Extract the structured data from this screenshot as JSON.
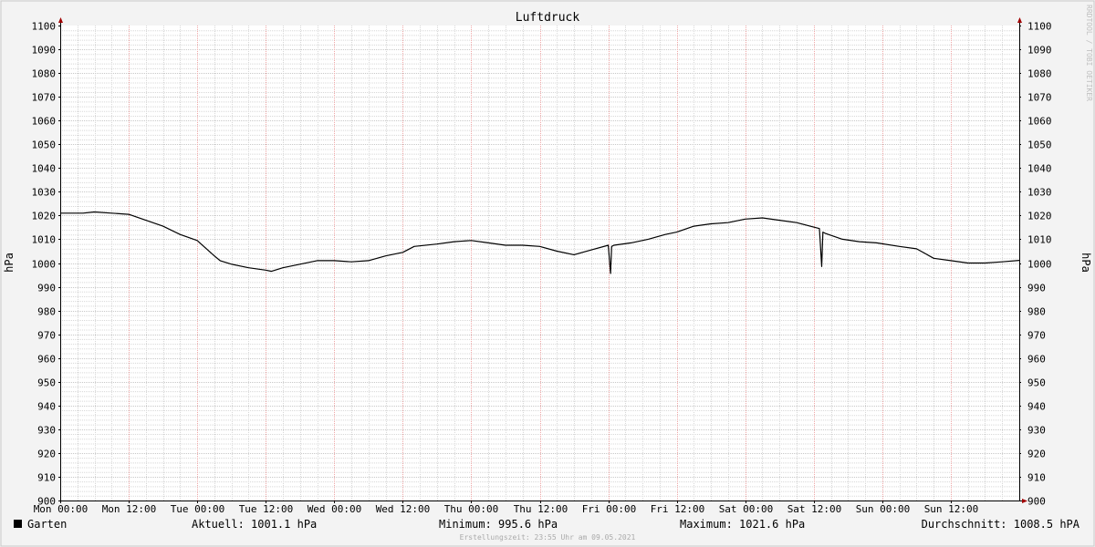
{
  "chart_data": {
    "type": "line",
    "title": "Luftdruck",
    "ylabel": "hPa",
    "ylim": [
      900,
      1100
    ],
    "y_ticks": [
      900,
      910,
      920,
      930,
      940,
      950,
      960,
      970,
      980,
      990,
      1000,
      1010,
      1020,
      1030,
      1040,
      1050,
      1060,
      1070,
      1080,
      1090,
      1100
    ],
    "x_range_hours": [
      0,
      168
    ],
    "x_ticks": [
      {
        "hour": 0,
        "label": "Mon 00:00"
      },
      {
        "hour": 12,
        "label": "Mon 12:00"
      },
      {
        "hour": 24,
        "label": "Tue 00:00"
      },
      {
        "hour": 36,
        "label": "Tue 12:00"
      },
      {
        "hour": 48,
        "label": "Wed 00:00"
      },
      {
        "hour": 60,
        "label": "Wed 12:00"
      },
      {
        "hour": 72,
        "label": "Thu 00:00"
      },
      {
        "hour": 84,
        "label": "Thu 12:00"
      },
      {
        "hour": 96,
        "label": "Fri 00:00"
      },
      {
        "hour": 108,
        "label": "Fri 12:00"
      },
      {
        "hour": 120,
        "label": "Sat 00:00"
      },
      {
        "hour": 132,
        "label": "Sat 12:00"
      },
      {
        "hour": 144,
        "label": "Sun 00:00"
      },
      {
        "hour": 156,
        "label": "Sun 12:00"
      }
    ],
    "grid": true,
    "legend_position": "bottom-left",
    "series": [
      {
        "name": "Garten",
        "color": "#000000",
        "x": [
          0,
          4,
          6,
          9,
          12,
          15,
          18,
          21,
          24,
          27,
          28,
          30,
          33,
          36,
          37,
          39,
          42,
          45,
          48,
          51,
          54,
          57,
          60,
          62,
          66,
          69,
          72,
          75,
          78,
          81,
          84,
          87,
          90,
          93,
          96,
          96.4,
          96.6,
          97,
          100,
          103,
          106,
          108,
          111,
          114,
          117,
          120,
          123,
          126,
          129,
          133,
          133.4,
          133.6,
          134,
          137,
          140,
          143,
          147,
          150,
          153,
          156,
          159,
          162,
          165,
          168
        ],
        "y": [
          1021,
          1021,
          1021.5,
          1021,
          1020.5,
          1018,
          1015.5,
          1012,
          1009.5,
          1003,
          1001,
          999.5,
          998,
          997,
          996.5,
          998,
          999.5,
          1001,
          1001,
          1000.5,
          1001,
          1003,
          1004.5,
          1007,
          1008,
          1009,
          1009.5,
          1008.5,
          1007.5,
          1007.5,
          1007,
          1005,
          1003.5,
          1005.5,
          1007.5,
          995.6,
          1007,
          1007.5,
          1008.5,
          1010,
          1012,
          1013,
          1015.5,
          1016.5,
          1017,
          1018.5,
          1019,
          1018,
          1017,
          1014.5,
          998.5,
          1013,
          1012.5,
          1010,
          1009,
          1008.5,
          1007,
          1006,
          1002,
          1001,
          1000,
          1000,
          1000.5,
          1001.1
        ]
      }
    ],
    "stats": {
      "current": "Aktuell: 1001.1 hPa",
      "minimum": "Minimum: 995.6 hPa",
      "maximum": "Maximum: 1021.6 hPa",
      "average": "Durchschnitt: 1008.5 hPA"
    },
    "footer": "Erstellungszeit: 23:55 Uhr am 09.05.2021",
    "watermark": "RRDTOOL / TOBI OETIKER",
    "colors": {
      "background": "#f3f3f3",
      "plot_background": "#ffffff",
      "minor_grid": "#d8d8d8",
      "major_grid_x": "#f0a8a8",
      "major_grid_y": "#c8c8c8",
      "line": "#000000",
      "arrow": "#a00000"
    }
  }
}
